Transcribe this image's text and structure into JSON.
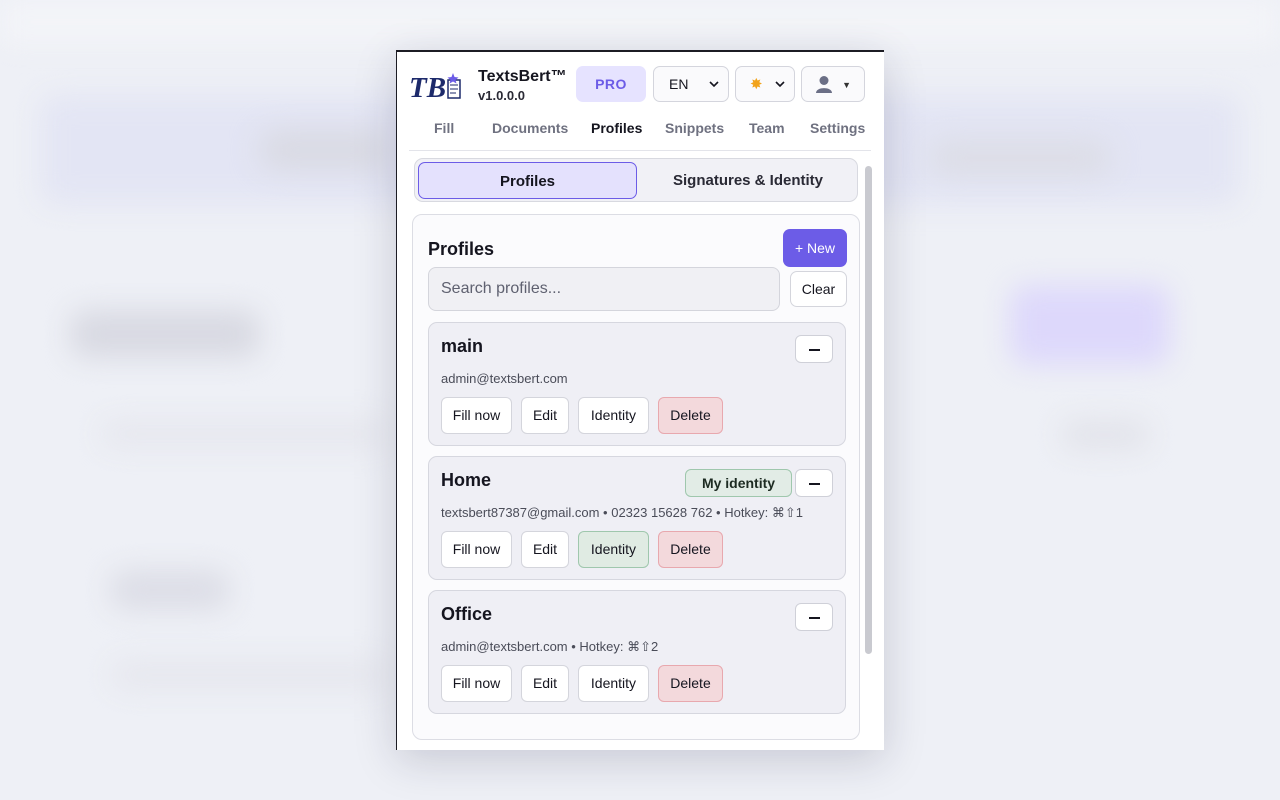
{
  "app": {
    "name": "TextsBert™",
    "version": "v1.0.0.0",
    "logo_text": "TB",
    "plan_badge": "PRO"
  },
  "header": {
    "language": "EN",
    "theme_icon": "sun-icon",
    "account_icon": "user-icon"
  },
  "nav": {
    "items": [
      "Fill",
      "Documents",
      "Profiles",
      "Snippets",
      "Team",
      "Settings"
    ],
    "active": "Profiles"
  },
  "subtabs": {
    "items": [
      "Profiles",
      "Signatures & Identity"
    ],
    "active": "Profiles"
  },
  "panel": {
    "title": "Profiles",
    "new_label": "+ New",
    "search_placeholder": "Search profiles...",
    "search_value": "",
    "clear_label": "Clear"
  },
  "profiles": [
    {
      "name": "main",
      "meta": "admin@textsbert.com",
      "badge": null,
      "identity_active": false
    },
    {
      "name": "Home",
      "meta": "textsbert87387@gmail.com • 02323 15628 762 • Hotkey: ⌘⇧1",
      "badge": "My identity",
      "identity_active": true
    },
    {
      "name": "Office",
      "meta": "admin@textsbert.com • Hotkey: ⌘⇧2",
      "badge": null,
      "identity_active": false
    }
  ],
  "actions": {
    "fill": "Fill now",
    "edit": "Edit",
    "identity": "Identity",
    "delete": "Delete"
  },
  "colors": {
    "accent": "#6c5ce7",
    "accent_light": "#e4e1fd",
    "identity_green": "#9fc7ad",
    "delete_red": "#f3d9dc"
  }
}
